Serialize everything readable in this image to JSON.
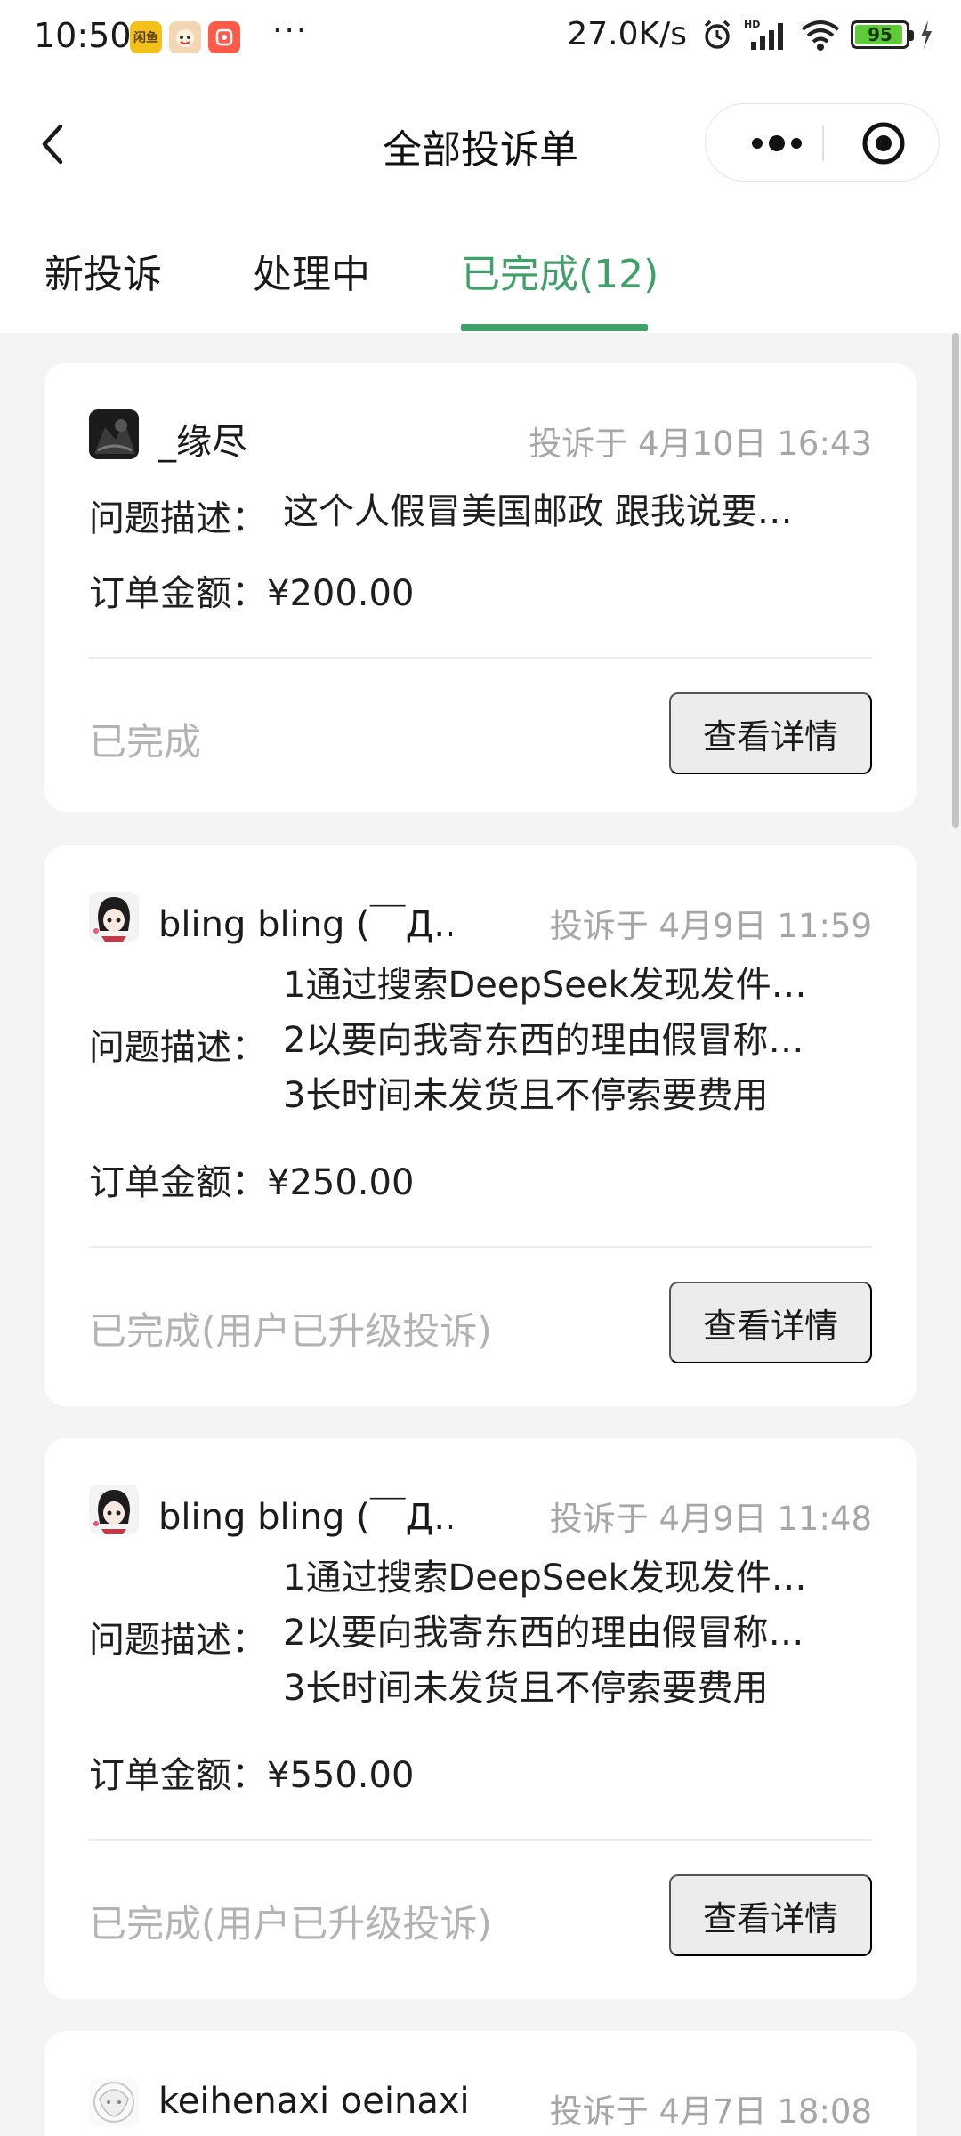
{
  "status_bar": {
    "time": "10:50",
    "app_icons": [
      {
        "name": "app-icon-yellow",
        "label": "闲鱼"
      },
      {
        "name": "app-icon-face",
        "label": ""
      },
      {
        "name": "app-icon-red",
        "label": ""
      }
    ],
    "more_dots": "···",
    "network_speed": "27.0K/s",
    "battery_level": "95",
    "battery_percent": 95
  },
  "nav": {
    "title": "全部投诉单"
  },
  "tabs": [
    {
      "label": "新投诉",
      "active": false
    },
    {
      "label": "处理中",
      "active": false
    },
    {
      "label": "已完成(12)",
      "active": true
    }
  ],
  "labels": {
    "desc_label": "问题描述：",
    "amount_label": "订单金额：",
    "detail_button": "查看详情"
  },
  "complaints": [
    {
      "user": "_缘尽",
      "time": "投诉于 4月10日 16:43",
      "desc": [
        "这个人假冒美国邮政 跟我说要…"
      ],
      "amount": "¥200.00",
      "status": "已完成"
    },
    {
      "user": "bling bling (￣Д…",
      "time": "投诉于 4月9日 11:59",
      "desc": [
        "1通过搜索DeepSeek发现发件…",
        "2以要向我寄东西的理由假冒称…",
        "3长时间未发货且不停索要费用"
      ],
      "amount": "¥250.00",
      "status": "已完成(用户已升级投诉)"
    },
    {
      "user": "bling bling (￣Д…",
      "time": "投诉于 4月9日 11:48",
      "desc": [
        "1通过搜索DeepSeek发现发件…",
        "2以要向我寄东西的理由假冒称…",
        "3长时间未发货且不停索要费用"
      ],
      "amount": "¥550.00",
      "status": "已完成(用户已升级投诉)"
    },
    {
      "user": "keihenaxi oeinaxi",
      "time": "投诉于 4月7日 18:08"
    }
  ],
  "colors": {
    "accent": "#3fa06a",
    "muted": "#b3b3b3",
    "background": "#f4f4f4"
  }
}
